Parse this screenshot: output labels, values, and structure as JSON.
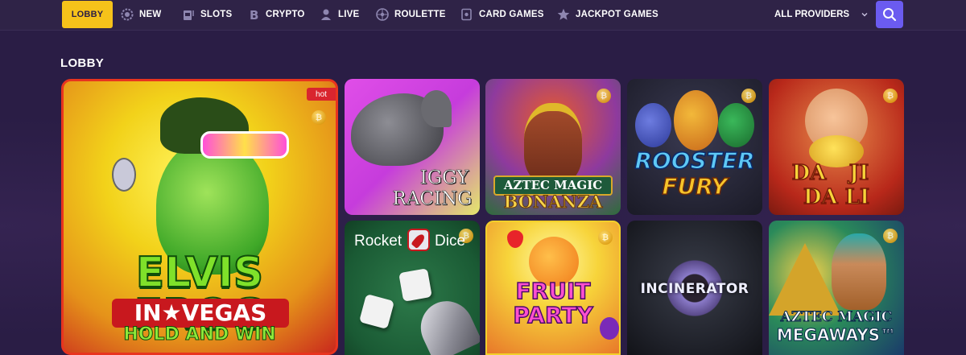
{
  "nav": {
    "lobby": "LOBBY",
    "items": [
      {
        "label": "NEW",
        "icon": "gear-icon"
      },
      {
        "label": "SLOTS",
        "icon": "slot-machine-icon"
      },
      {
        "label": "CRYPTO",
        "icon": "bitcoin-icon"
      },
      {
        "label": "LIVE",
        "icon": "live-dealer-icon"
      },
      {
        "label": "ROULETTE",
        "icon": "roulette-icon"
      },
      {
        "label": "CARD GAMES",
        "icon": "cards-icon"
      },
      {
        "label": "JACKPOT GAMES",
        "icon": "star-icon"
      }
    ],
    "providers": "ALL PROVIDERS",
    "accent": "#f6c21a",
    "search_color": "#6b5bf0"
  },
  "section": {
    "title": "LOBBY"
  },
  "games": [
    {
      "title_l1": "ELVIS FROG",
      "title_l2": "IN★VEGAS",
      "title_l3": "HOLD AND WIN",
      "badge": "hot",
      "crypto": "₿"
    },
    {
      "title_l1": "IGGY",
      "title_l2": "RACING"
    },
    {
      "title_l1": "AZTEC MAGIC",
      "title_l2": "BONANZA",
      "crypto": "₿"
    },
    {
      "title_l1": "ROOSTER",
      "title_l2": "FURY",
      "crypto": "₿"
    },
    {
      "title_l1": "DA",
      "title_l2": "JI",
      "title_l3": "DA LI",
      "crypto": "₿"
    },
    {
      "title_l1": "Rocket",
      "title_l2": "Dice",
      "crypto": "₿"
    },
    {
      "title_l1": "FRUIT",
      "title_l2": "PARTY",
      "crypto": "₿"
    },
    {
      "title_l1": "INCINERATOR"
    },
    {
      "title_l1": "AZTEC MAGIC",
      "title_l2": "MEGAWAYS™",
      "crypto": "₿"
    }
  ]
}
